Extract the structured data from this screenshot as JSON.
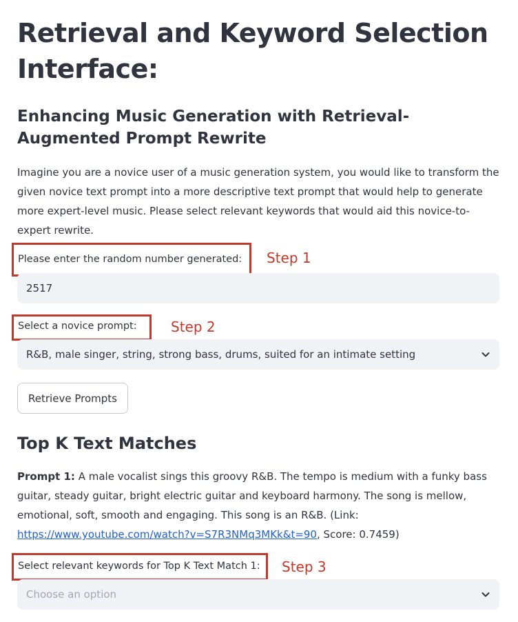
{
  "title": "Retrieval and Keyword Selection Interface:",
  "subtitle": "Enhancing Music Generation with Retrieval-Augmented Prompt Rewrite",
  "intro": "Imagine you are a novice user of a music generation system, you would like to transform the given novice text prompt into a more descriptive text prompt that would help to generate more expert-level music. Please select relevant keywords that would aid this novice-to-expert rewrite.",
  "random_number": {
    "label": "Please enter the random number generated:",
    "value": "2517",
    "step": "Step 1"
  },
  "novice_prompt": {
    "label": "Select a novice prompt:",
    "selected": "R&B, male singer, string, strong bass, drums, suited for an intimate setting",
    "step": "Step 2"
  },
  "retrieve_button": "Retrieve Prompts",
  "matches_heading": "Top K Text Matches",
  "prompt1": {
    "label": "Prompt 1:",
    "text": "A male vocalist sings this groovy R&B. The tempo is medium with a funky bass guitar, steady guitar, bright electric guitar and keyboard harmony. The song is mellow, emotional, soft, smooth and engaging. This song is an R&B. (Link: ",
    "link": "https://www.youtube.com/watch?v=S7R3NMq3MKk&t=90",
    "suffix": ", Score: 0.7459)"
  },
  "keywords": {
    "label": "Select relevant keywords for Top K Text Match 1:",
    "placeholder": "Choose an option",
    "step": "Step 3"
  },
  "colors": {
    "annotation": "#c0392b",
    "link": "#1f5fd6",
    "input_bg": "#f0f2f6",
    "text": "#31333f"
  },
  "icons": [
    "chevron-down-icon"
  ]
}
